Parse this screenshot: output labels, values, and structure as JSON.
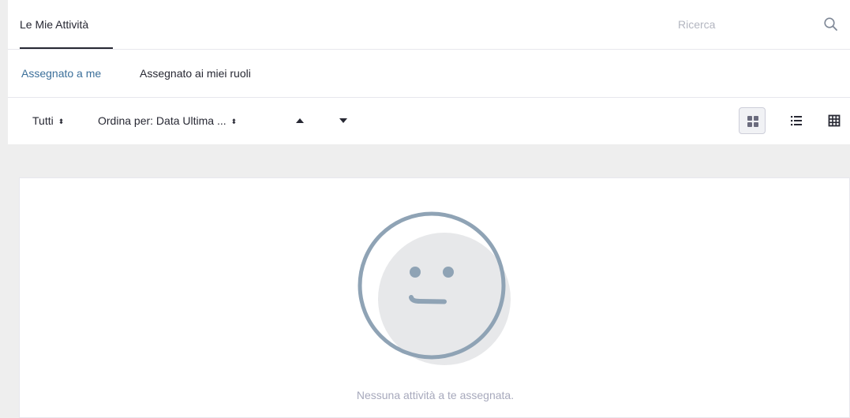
{
  "header": {
    "page_tab_label": "Le Mie Attività",
    "search": {
      "placeholder": "Ricerca",
      "value": ""
    }
  },
  "subnav": {
    "assigned_to_me": "Assegnato a me",
    "assigned_to_my_roles": "Assegnato ai miei ruoli"
  },
  "toolbar": {
    "filter_label": "Tutti",
    "sort_label": "Ordina per: Data Ultima ...",
    "sort_ascending_icon": "triangle-up-icon",
    "sort_descending_icon": "triangle-down-icon",
    "views": [
      {
        "name": "cards-view",
        "icon": "grid-icon",
        "active": true
      },
      {
        "name": "list-view",
        "icon": "list-icon",
        "active": false
      },
      {
        "name": "table-view",
        "icon": "table-icon",
        "active": false
      }
    ]
  },
  "empty_state": {
    "illustration": "neutral-face-icon",
    "message": "Nessuna attività a te assegnata."
  },
  "colors": {
    "page_background": "#eeeeee",
    "panel_background": "#ffffff",
    "active_link": "#3b6f9a",
    "text_primary": "#272833",
    "text_muted": "#a7a9bc",
    "illustration_stroke": "#8fa3b5",
    "illustration_fill": "#e7e8ea"
  }
}
